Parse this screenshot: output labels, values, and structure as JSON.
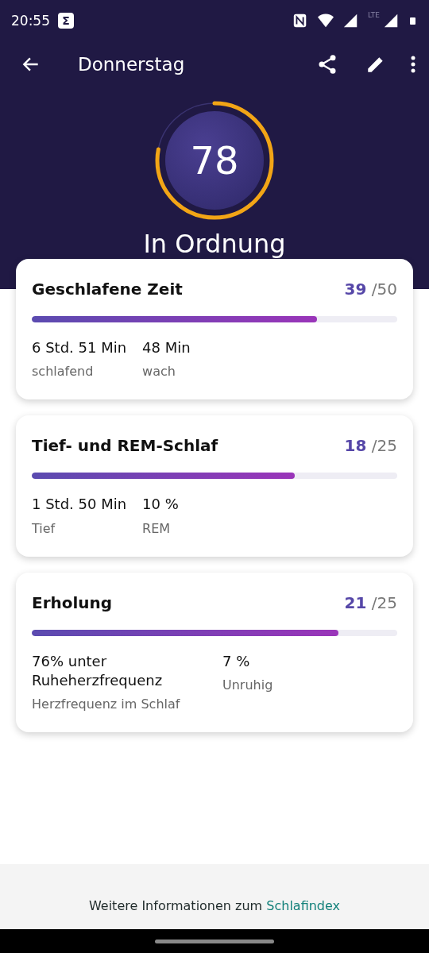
{
  "status_bar": {
    "time": "20:55",
    "app_badge": "Σ",
    "network": "LTE"
  },
  "app_bar": {
    "title": "Donnerstag"
  },
  "score": {
    "value": "78",
    "rating": "In Ordnung"
  },
  "cards": [
    {
      "title": "Geschlafene Zeit",
      "points": "39",
      "max": "/50",
      "level": 0.78,
      "stats": [
        {
          "value": "6 Std. 51 Min",
          "label": "schlafend"
        },
        {
          "value": "48 Min",
          "label": "wach"
        }
      ]
    },
    {
      "title": "Tief- und REM-Schlaf",
      "points": "18",
      "max": "/25",
      "level": 0.72,
      "stats": [
        {
          "value": "1 Std. 50 Min",
          "label": "Tief"
        },
        {
          "value": "10 %",
          "label": "REM"
        }
      ]
    },
    {
      "title": "Erholung",
      "points": "21",
      "max": "/25",
      "level": 0.84,
      "stats": [
        {
          "value": "76% unter Ruheherzfrequenz",
          "label": "Herzfrequenz im Schlaf"
        },
        {
          "value": "7 %",
          "label": "Unruhig"
        }
      ]
    }
  ],
  "footer": {
    "text": "Weitere Informationen zum",
    "link": "Schlafindex"
  }
}
